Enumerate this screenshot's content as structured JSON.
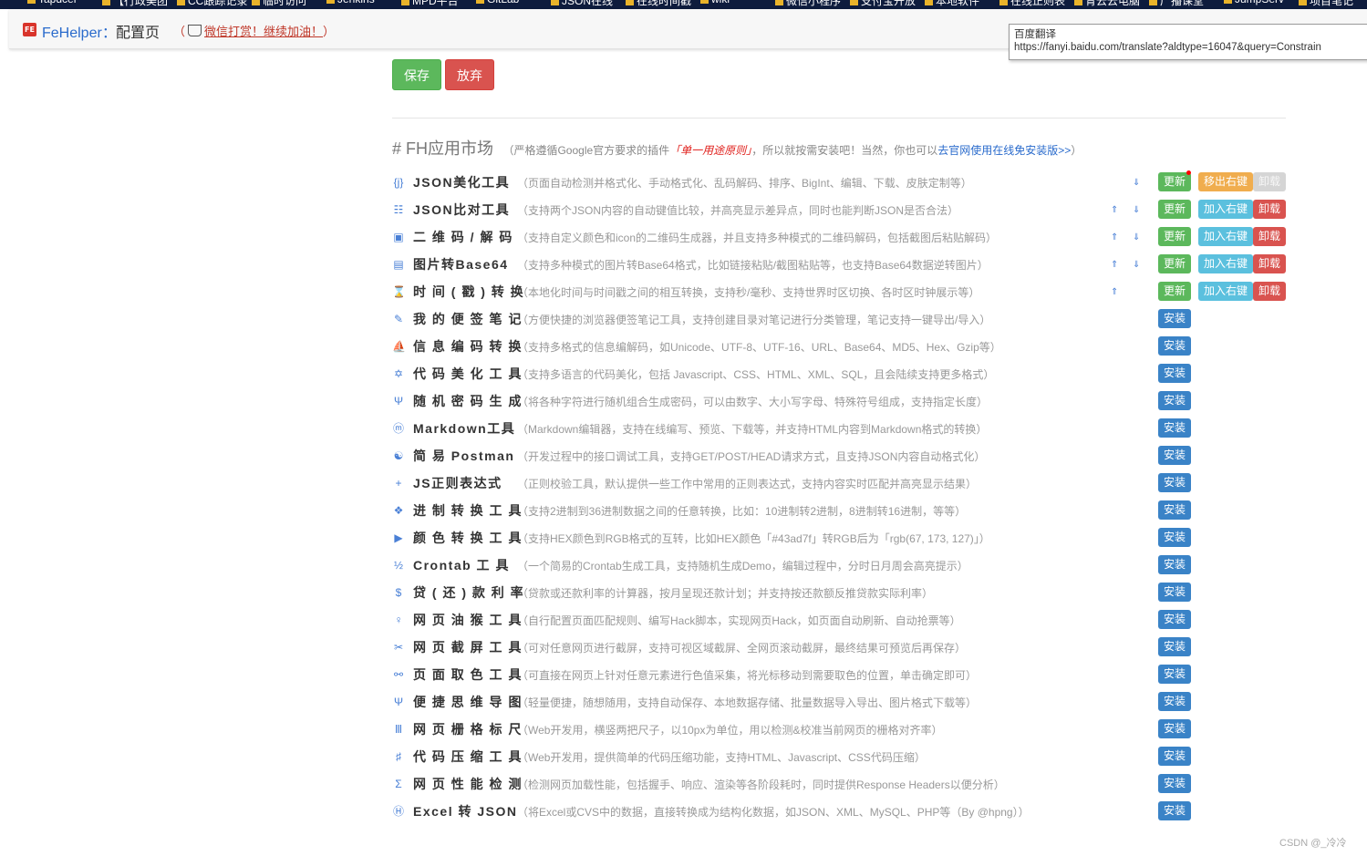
{
  "bookmarks": [
    {
      "label": "Tapdcer"
    },
    {
      "label": "【行政美团"
    },
    {
      "label": "CC跟踪记录"
    },
    {
      "label": "临时访问"
    },
    {
      "label": "Jenkins"
    },
    {
      "label": "MPD平台"
    },
    {
      "label": "GitLab"
    },
    {
      "label": "JSON在线"
    },
    {
      "label": "在线时间戳"
    },
    {
      "label": "wiki"
    },
    {
      "label": "微信小程序"
    },
    {
      "label": "支付宝开放"
    },
    {
      "label": "本地软件"
    },
    {
      "label": "在线正则表"
    },
    {
      "label": "青云云电脑"
    },
    {
      "label": "广播课堂"
    },
    {
      "label": "JumpServ"
    },
    {
      "label": "项目笔记"
    }
  ],
  "header": {
    "brand": "FeHelper",
    "separator": "：",
    "page_title": "配置页",
    "donate_open": "（",
    "donate_link": "微信打赏！继续加油！",
    "donate_close": "）"
  },
  "tooltip": {
    "title": "百度翻译",
    "url": "https://fanyi.baidu.com/translate?aldtype=16047&query=Constrain"
  },
  "actions": {
    "save": "保存",
    "discard": "放弃"
  },
  "market": {
    "title": "# FH应用市场",
    "note_prefix": "（严格遵循Google官方要求的插件",
    "note_emphasis": "「单一用途原则」",
    "note_middle": "，所以就按需安装吧！当然，你也可以",
    "note_link": "去官网使用在线免安装版>>",
    "note_suffix": "）"
  },
  "button_labels": {
    "update": "更新",
    "remove_context": "移出右键",
    "add_context": "加入右键",
    "uninstall": "卸载",
    "install": "安装"
  },
  "tools": [
    {
      "icon": "{j}",
      "icon_name": "json-format-icon",
      "name": "JSON美化工具",
      "desc": "（页面自动检测并格式化、手动格式化、乱码解码、排序、BigInt、编辑、下载、皮肤定制等）",
      "installed": true,
      "up": false,
      "down": true,
      "menu": "remove",
      "uninstall_disabled": true,
      "notify": true
    },
    {
      "icon": "☷",
      "icon_name": "json-diff-icon",
      "name": "JSON比对工具",
      "desc": "（支持两个JSON内容的自动键值比较，并高亮显示差异点，同时也能判断JSON是否合法）",
      "installed": true,
      "up": true,
      "down": true,
      "menu": "add"
    },
    {
      "icon": "▣",
      "icon_name": "qrcode-icon",
      "name": "二 维 码 / 解 码",
      "desc": "（支持自定义颜色和icon的二维码生成器，并且支持多种模式的二维码解码，包括截图后粘贴解码）",
      "installed": true,
      "up": true,
      "down": true,
      "menu": "add"
    },
    {
      "icon": "▤",
      "icon_name": "image-base64-icon",
      "name": "图片转Base64",
      "desc": "（支持多种模式的图片转Base64格式，比如链接粘贴/截图粘贴等，也支持Base64数据逆转图片）",
      "installed": true,
      "up": true,
      "down": true,
      "menu": "add"
    },
    {
      "icon": "⌛",
      "icon_name": "hourglass-icon",
      "name": "时 间 ( 戳 ) 转 换",
      "desc": "（本地化时间与时间戳之间的相互转换，支持秒/毫秒、支持世界时区切换、各时区时钟展示等）",
      "installed": true,
      "up": true,
      "down": false,
      "menu": "add"
    },
    {
      "icon": "✎",
      "icon_name": "pencil-icon",
      "name": "我 的 便 签 笔 记",
      "desc": "（方便快捷的浏览器便签笔记工具，支持创建目录对笔记进行分类管理，笔记支持一键导出/导入）",
      "installed": false
    },
    {
      "icon": "⛵",
      "icon_name": "ship-icon",
      "name": "信 息 编 码 转 换",
      "desc": "（支持多格式的信息编解码，如Unicode、UTF-8、UTF-16、URL、Base64、MD5、Hex、Gzip等）",
      "installed": false
    },
    {
      "icon": "✡",
      "icon_name": "star-icon",
      "name": "代 码 美 化 工 具",
      "desc": "（支持多语言的代码美化，包括 Javascript、CSS、HTML、XML、SQL，且会陆续支持更多格式）",
      "installed": false
    },
    {
      "icon": "Ψ",
      "icon_name": "psi-icon",
      "name": "随 机 密 码 生 成",
      "desc": "（将各种字符进行随机组合生成密码，可以由数字、大小写字母、特殊符号组成，支持指定长度）",
      "installed": false
    },
    {
      "icon": "ⓜ",
      "icon_name": "markdown-icon",
      "name": "Markdown工具",
      "desc": "（Markdown编辑器，支持在线编写、预览、下载等，并支持HTML内容到Markdown格式的转换）",
      "installed": false
    },
    {
      "icon": "☯",
      "icon_name": "yin-yang-icon",
      "name": "简 易  Postman",
      "desc": "（开发过程中的接口调试工具，支持GET/POST/HEAD请求方式，且支持JSON内容自动格式化）",
      "installed": false
    },
    {
      "icon": "+",
      "icon_name": "plus-icon",
      "name": "JS正则表达式",
      "desc": "（正则校验工具，默认提供一些工作中常用的正则表达式，支持内容实时匹配并高亮显示结果）",
      "installed": false
    },
    {
      "icon": "❖",
      "icon_name": "diamond-icon",
      "name": "进 制 转 换 工 具",
      "desc": "（支持2进制到36进制数据之间的任意转换，比如：10进制转2进制，8进制转16进制，等等）",
      "installed": false
    },
    {
      "icon": "▶",
      "icon_name": "play-icon",
      "name": "颜 色 转 换 工 具",
      "desc": "（支持HEX颜色到RGB格式的互转，比如HEX颜色「#43ad7f」转RGB后为「rgb(67, 173, 127)」）",
      "installed": false
    },
    {
      "icon": "½",
      "icon_name": "half-icon",
      "name": "Crontab  工  具",
      "desc": "（一个简易的Crontab生成工具，支持随机生成Demo，编辑过程中，分时日月周会高亮提示）",
      "installed": false
    },
    {
      "icon": "$",
      "icon_name": "dollar-icon",
      "name": "贷 ( 还 ) 款 利 率",
      "desc": "（贷款或还款利率的计算器，按月呈现还款计划；并支持按还款额反推贷款实际利率）",
      "installed": false
    },
    {
      "icon": "♀",
      "icon_name": "monkey-icon",
      "name": "网 页 油 猴 工 具",
      "desc": "（自行配置页面匹配规则、编写Hack脚本，实现网页Hack，如页面自动刷新、自动抢票等）",
      "installed": false
    },
    {
      "icon": "✂",
      "icon_name": "scissors-icon",
      "name": "网 页 截 屏 工 具",
      "desc": "（可对任意网页进行截屏，支持可视区域截屏、全网页滚动截屏，最终结果可预览后再保存）",
      "installed": false
    },
    {
      "icon": "⚯",
      "icon_name": "color-picker-icon",
      "name": "页 面 取 色 工 具",
      "desc": "（可直接在网页上针对任意元素进行色值采集，将光标移动到需要取色的位置，单击确定即可）",
      "installed": false
    },
    {
      "icon": "Ψ",
      "icon_name": "mindmap-icon",
      "name": "便 捷 思 维 导 图",
      "desc": "（轻量便捷，随想随用，支持自动保存、本地数据存储、批量数据导入导出、图片格式下载等）",
      "installed": false
    },
    {
      "icon": "Ⅲ",
      "icon_name": "ruler-icon",
      "name": "网 页 栅 格 标 尺",
      "desc": "（Web开发用，横竖两把尺子，以10px为单位，用以检测&校准当前网页的栅格对齐率）",
      "installed": false
    },
    {
      "icon": "♯",
      "icon_name": "compress-icon",
      "name": "代 码 压 缩 工 具",
      "desc": "（Web开发用，提供简单的代码压缩功能，支持HTML、Javascript、CSS代码压缩）",
      "installed": false
    },
    {
      "icon": "Σ",
      "icon_name": "sigma-icon",
      "name": "网 页 性 能 检 测",
      "desc": "（检测网页加载性能，包括握手、响应、渲染等各阶段耗时，同时提供Response Headers以便分析）",
      "installed": false
    },
    {
      "icon": "Ⓗ",
      "icon_name": "excel-icon",
      "name": "Excel 转 JSON",
      "desc": "（将Excel或CVS中的数据，直接转换成为结构化数据，如JSON、XML、MySQL、PHP等（By @hpng））",
      "installed": false
    }
  ],
  "footer": "CSDN @_冷冷",
  "colors": {
    "install": "#3a83c7",
    "update": "#5cb85c",
    "uninstall": "#d9534f",
    "add_context": "#5bc0de",
    "remove_context": "#f0ad4e"
  }
}
